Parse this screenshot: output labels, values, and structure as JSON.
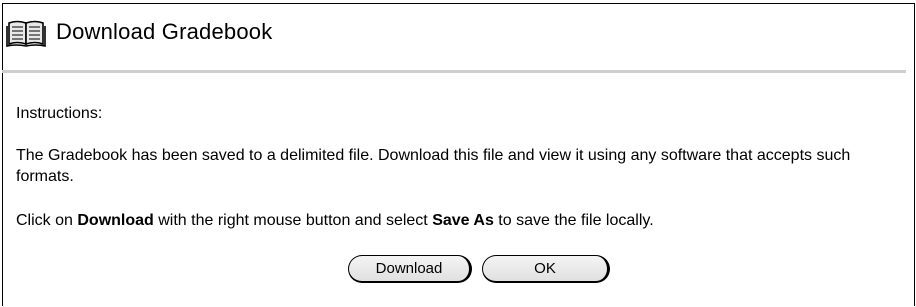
{
  "header": {
    "title": "Download Gradebook",
    "icon": "book-icon"
  },
  "content": {
    "instructions_label": "Instructions:",
    "paragraph": "The Gradebook has been saved to a delimited file. Download this file and view it using any software that accepts such formats.",
    "hint": {
      "part1": "Click on ",
      "download_word": "Download",
      "part2": " with the right mouse button and select ",
      "save_as_word": "Save As",
      "part3": " to save the file locally."
    }
  },
  "buttons": {
    "download_label": "Download",
    "ok_label": "OK"
  },
  "colors": {
    "rule": "#cfcfcf",
    "button_bg": "#e8e8e8"
  }
}
